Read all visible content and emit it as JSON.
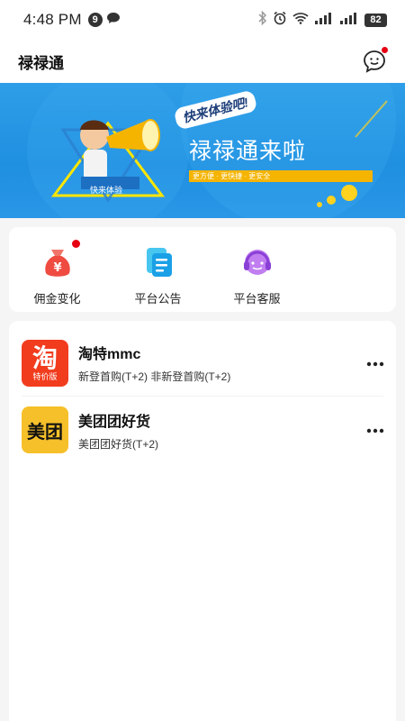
{
  "status_bar": {
    "time": "4:48 PM",
    "notification_count": "9",
    "battery": "82"
  },
  "header": {
    "title": "禄禄通"
  },
  "banner": {
    "slogan": "快来体验吧!",
    "headline": "禄禄通来啦",
    "tagline": "更方便 · 更快捷 · 更安全",
    "cta": "快来体验"
  },
  "quick_menu": [
    {
      "label": "佣金变化",
      "icon": "money-bag-icon",
      "has_badge": true
    },
    {
      "label": "平台公告",
      "icon": "announcement-icon",
      "has_badge": false
    },
    {
      "label": "平台客服",
      "icon": "customer-service-icon",
      "has_badge": false
    }
  ],
  "stores": [
    {
      "name": "淘特mmc",
      "desc": "新登首购(T+2)  非新登首购(T+2)",
      "logo_text": "淘",
      "logo_sub": "特价版"
    },
    {
      "name": "美团团好货",
      "desc": "美团团好货(T+2)",
      "logo_text": "美团"
    }
  ],
  "colors": {
    "accent_red": "#e60012",
    "banner_blue": "#2196e6",
    "taobao_orange": "#f23c1e",
    "meituan_yellow": "#f6c02a"
  }
}
